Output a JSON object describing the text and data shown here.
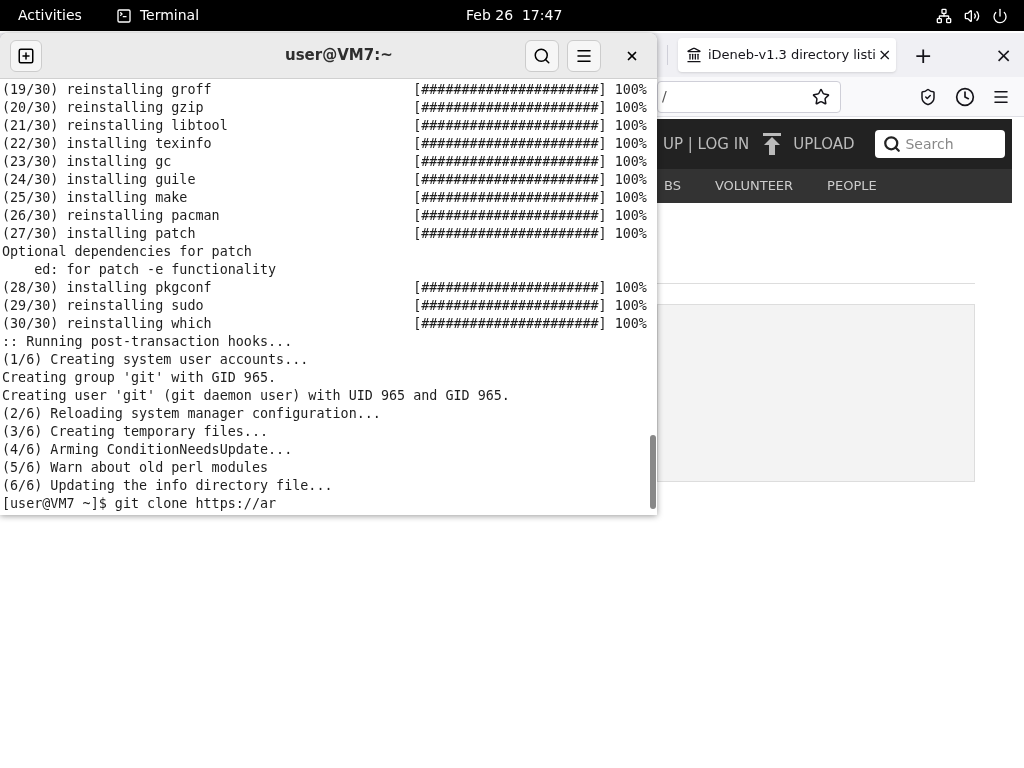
{
  "top_bar": {
    "activities": "Activities",
    "app": "Terminal",
    "clock": "Feb 26  17:47"
  },
  "terminal": {
    "title": "user@VM7:~",
    "lines": [
      {
        "kind": "progress",
        "text": "(19/30) reinstalling groff",
        "bar": "[######################]",
        "percent": "100%"
      },
      {
        "kind": "progress",
        "text": "(20/30) reinstalling gzip",
        "bar": "[######################]",
        "percent": "100%"
      },
      {
        "kind": "progress",
        "text": "(21/30) reinstalling libtool",
        "bar": "[######################]",
        "percent": "100%"
      },
      {
        "kind": "progress",
        "text": "(22/30) installing texinfo",
        "bar": "[######################]",
        "percent": "100%"
      },
      {
        "kind": "progress",
        "text": "(23/30) installing gc",
        "bar": "[######################]",
        "percent": "100%"
      },
      {
        "kind": "progress",
        "text": "(24/30) installing guile",
        "bar": "[######################]",
        "percent": "100%"
      },
      {
        "kind": "progress",
        "text": "(25/30) installing make",
        "bar": "[######################]",
        "percent": "100%"
      },
      {
        "kind": "progress",
        "text": "(26/30) reinstalling pacman",
        "bar": "[######################]",
        "percent": "100%"
      },
      {
        "kind": "progress",
        "text": "(27/30) installing patch",
        "bar": "[######################]",
        "percent": "100%"
      },
      {
        "kind": "text",
        "text": "Optional dependencies for patch"
      },
      {
        "kind": "text",
        "text": "    ed: for patch -e functionality"
      },
      {
        "kind": "progress",
        "text": "(28/30) installing pkgconf",
        "bar": "[######################]",
        "percent": "100%"
      },
      {
        "kind": "progress",
        "text": "(29/30) reinstalling sudo",
        "bar": "[######################]",
        "percent": "100%"
      },
      {
        "kind": "progress",
        "text": "(30/30) reinstalling which",
        "bar": "[######################]",
        "percent": "100%"
      },
      {
        "kind": "text",
        "text": ":: Running post-transaction hooks..."
      },
      {
        "kind": "text",
        "text": "(1/6) Creating system user accounts..."
      },
      {
        "kind": "text",
        "text": "Creating group 'git' with GID 965."
      },
      {
        "kind": "text",
        "text": "Creating user 'git' (git daemon user) with UID 965 and GID 965."
      },
      {
        "kind": "text",
        "text": "(2/6) Reloading system manager configuration..."
      },
      {
        "kind": "text",
        "text": "(3/6) Creating temporary files..."
      },
      {
        "kind": "text",
        "text": "(4/6) Arming ConditionNeedsUpdate..."
      },
      {
        "kind": "text",
        "text": "(5/6) Warn about old perl modules"
      },
      {
        "kind": "text",
        "text": "(6/6) Updating the info directory file..."
      },
      {
        "kind": "text",
        "text": "[user@VM7 ~]$ git clone https://ar"
      }
    ]
  },
  "browser": {
    "tab": {
      "title": "iDeneb-v1.3 directory listi",
      "close": "×"
    },
    "new_tab": "+",
    "close": "×",
    "url": "/",
    "header": {
      "account": "UP | LOG IN",
      "upload": "UPLOAD",
      "search": {
        "placeholder": "Search"
      }
    },
    "nav": [
      "BS",
      "VOLUNTEER",
      "PEOPLE"
    ]
  }
}
